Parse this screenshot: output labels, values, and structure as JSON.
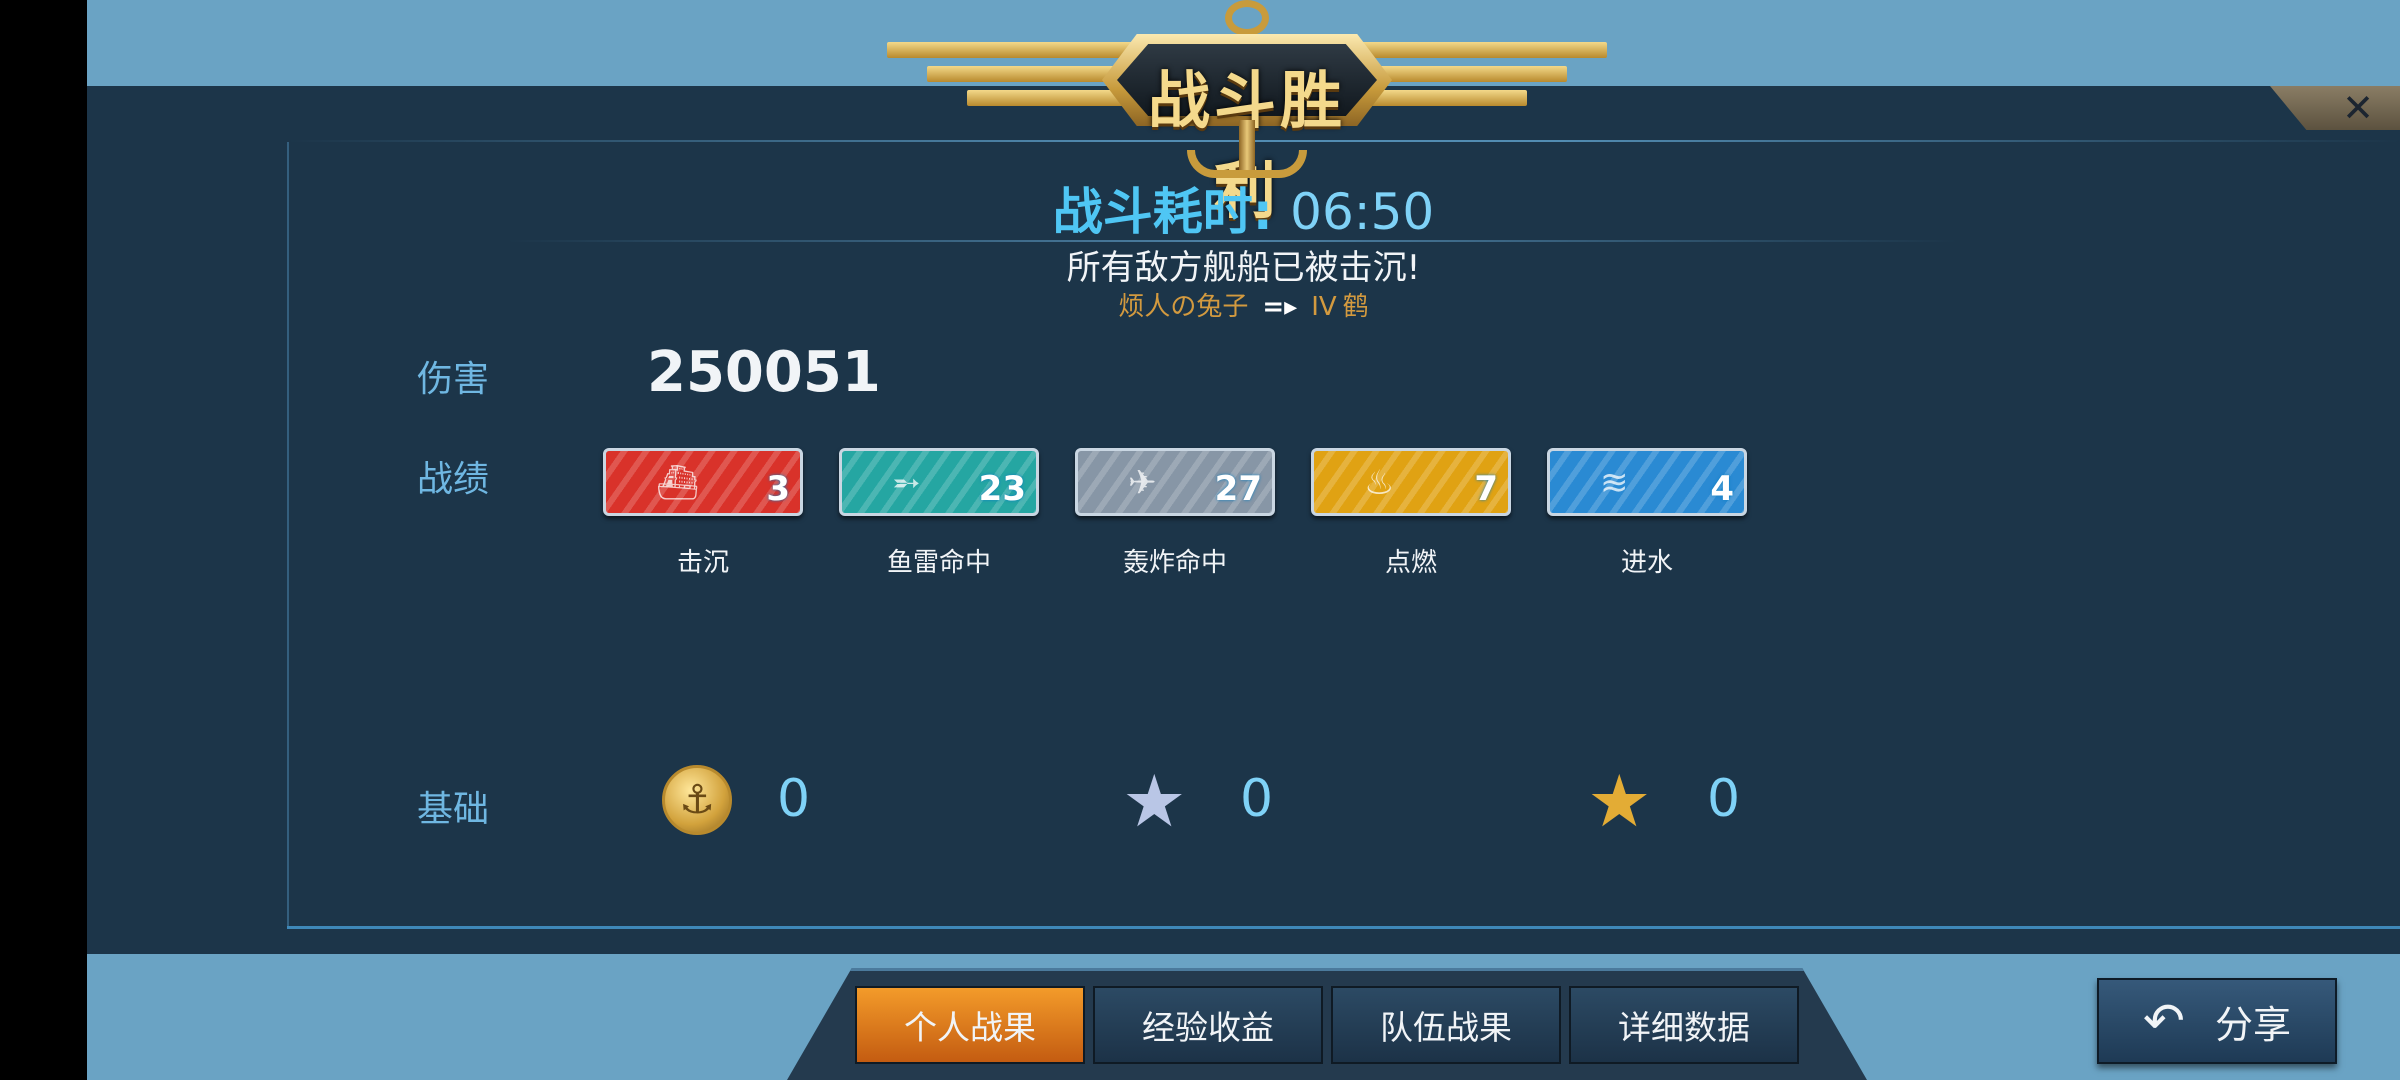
{
  "header": {
    "title": "战斗胜利",
    "close_icon": "close-icon"
  },
  "summary": {
    "time_label": "战斗耗时: ",
    "time_value": "06:50",
    "result_text": "所有敌方舰船已被击沉!",
    "player_name": "烦人の兔子",
    "arrow": "=▸",
    "ship_tier": "IV",
    "ship_name": "鹤"
  },
  "stats": {
    "damage_label": "伤害",
    "damage_value": "250051",
    "record_label": "战绩",
    "badges": [
      {
        "icon": "ship-icon",
        "glyph": "⛴",
        "color": "#d9322a",
        "value": "3",
        "caption": "击沉"
      },
      {
        "icon": "torpedo-icon",
        "glyph": "➵",
        "color": "#25a6a2",
        "value": "23",
        "caption": "鱼雷命中"
      },
      {
        "icon": "plane-icon",
        "glyph": "✈",
        "color": "#8796a6",
        "value": "27",
        "caption": "轰炸命中"
      },
      {
        "icon": "fire-icon",
        "glyph": "♨",
        "color": "#e0a213",
        "value": "7",
        "caption": "点燃"
      },
      {
        "icon": "flood-icon",
        "glyph": "≋",
        "color": "#2a8ad3",
        "value": "4",
        "caption": "进水"
      }
    ],
    "base_label": "基础",
    "resources": [
      {
        "icon": "coin-icon",
        "value": "0"
      },
      {
        "icon": "silver-star-icon",
        "value": "0"
      },
      {
        "icon": "gold-star-icon",
        "value": "0"
      }
    ]
  },
  "tabs": [
    {
      "label": "个人战果",
      "active": true
    },
    {
      "label": "经验收益",
      "active": false
    },
    {
      "label": "队伍战果",
      "active": false
    },
    {
      "label": "详细数据",
      "active": false
    }
  ],
  "share": {
    "label": "分享",
    "icon": "share-icon"
  },
  "colors": {
    "panel": "#1c3549",
    "accent_blue": "#4fc6f4",
    "active_tab": "#f39b2a"
  }
}
